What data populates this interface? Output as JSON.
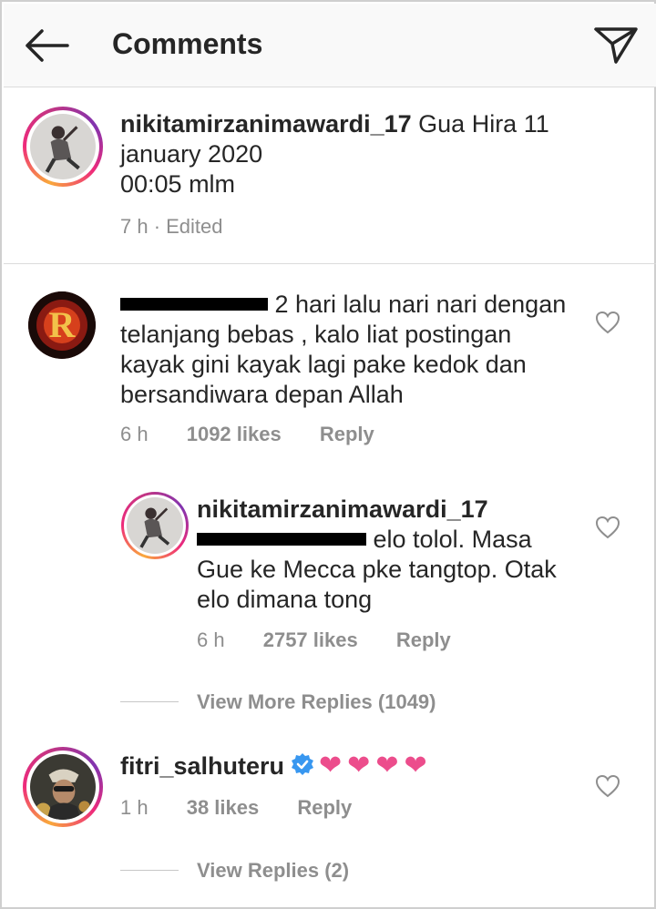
{
  "header": {
    "title": "Comments",
    "back_icon": "arrow-left-icon",
    "share_icon": "paper-plane-icon"
  },
  "caption": {
    "username": "nikitamirzanimawardi_17",
    "text_line1": "Gua Hira 11",
    "text_line2": "january 2020",
    "text_line3": "00:05 mlm",
    "meta": "7 h · Edited"
  },
  "comments": [
    {
      "username_redacted": true,
      "text_line1": "2 hari lalu nari nari dengan",
      "text_line2": "telanjang bebas , kalo liat postingan",
      "text_line3": "kayak gini kayak lagi pake kedok dan",
      "text_line4": "bersandiwara depan Allah",
      "time": "6 h",
      "likes": "1092 likes",
      "reply": "Reply"
    }
  ],
  "reply": {
    "username": "nikitamirzanimawardi_17",
    "mention_redacted": true,
    "text_line1": "elo tolol. Masa",
    "text_line2": "Gue ke Mecca pke tangtop. Otak",
    "text_line3": "elo dimana tong",
    "time": "6 h",
    "likes": "2757 likes",
    "reply": "Reply",
    "view_more": "View More Replies (1049)"
  },
  "comment2": {
    "username": "fitri_salhuteru",
    "verified": true,
    "hearts": "❤❤❤❤",
    "time": "1 h",
    "likes": "38 likes",
    "reply": "Reply",
    "view_replies": "View Replies (2)"
  },
  "colors": {
    "accent_link": "#003569",
    "muted": "#8e8e8e",
    "verified_blue": "#3897f0",
    "heart_pink": "#ec4d8c"
  }
}
